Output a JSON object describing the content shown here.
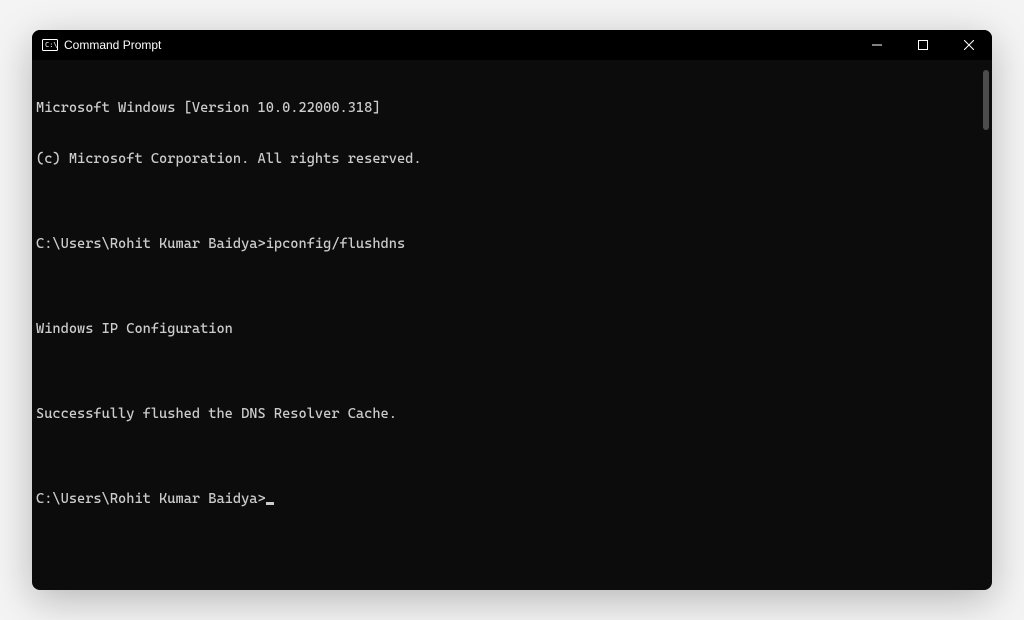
{
  "window": {
    "title": "Command Prompt"
  },
  "terminal": {
    "lines": [
      "Microsoft Windows [Version 10.0.22000.318]",
      "(c) Microsoft Corporation. All rights reserved.",
      "",
      "C:\\Users\\Rohit Kumar Baidya>ipconfig/flushdns",
      "",
      "Windows IP Configuration",
      "",
      "Successfully flushed the DNS Resolver Cache.",
      "",
      "C:\\Users\\Rohit Kumar Baidya>"
    ]
  }
}
